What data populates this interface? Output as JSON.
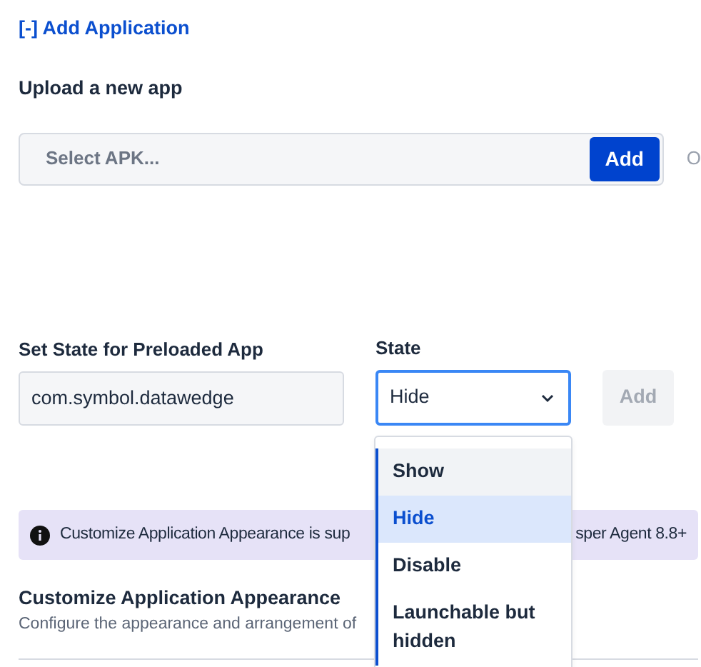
{
  "section_toggle": "[-] Add Application",
  "upload": {
    "title": "Upload a new app",
    "placeholder": "Select APK...",
    "button": "Add",
    "cut_text": "O"
  },
  "preloaded": {
    "label": "Set State for Preloaded App",
    "value": "com.symbol.datawedge",
    "state_label": "State",
    "state_value": "Hide",
    "button": "Add",
    "button_disabled": true
  },
  "state_menu": [
    {
      "label": "Show",
      "selected": false,
      "hovered": true
    },
    {
      "label": "Hide",
      "selected": true,
      "hovered": false
    },
    {
      "label": "Disable",
      "selected": false,
      "hovered": false
    },
    {
      "label": "Launchable but hidden",
      "selected": false,
      "hovered": false
    }
  ],
  "notice": {
    "text_left": "Customize Application Appearance is sup",
    "text_right": "sper Agent 8.8+"
  },
  "appearance": {
    "title": "Customize Application Appearance",
    "description": "Configure the appearance and arrangement of"
  }
}
